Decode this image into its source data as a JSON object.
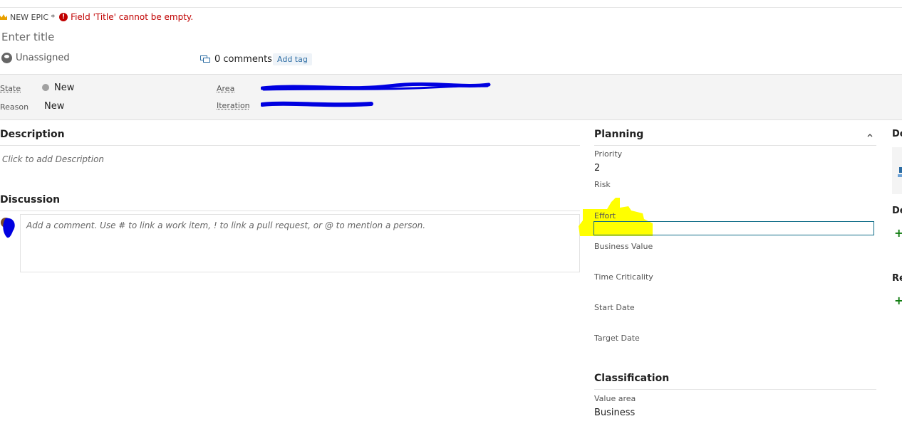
{
  "header": {
    "type_label": "NEW EPIC *",
    "error_text": "Field 'Title' cannot be empty."
  },
  "title": {
    "placeholder": "Enter title",
    "value": ""
  },
  "assignment": {
    "label": "Unassigned"
  },
  "comments": {
    "label": "0 comments"
  },
  "tags": {
    "add_label": "Add tag"
  },
  "state_band": {
    "state_label": "State",
    "state_value": "New",
    "reason_label": "Reason",
    "reason_value": "New",
    "area_label": "Area",
    "iteration_label": "Iteration"
  },
  "description": {
    "title": "Description",
    "placeholder": "Click to add Description"
  },
  "discussion": {
    "title": "Discussion",
    "placeholder": "Add a comment. Use # to link a work item, ! to link a pull request, or @ to mention a person."
  },
  "planning": {
    "title": "Planning",
    "fields": [
      {
        "label": "Priority",
        "value": "2"
      },
      {
        "label": "Risk",
        "value": ""
      },
      {
        "label": "Effort",
        "value": ""
      },
      {
        "label": "Business Value",
        "value": ""
      },
      {
        "label": "Time Criticality",
        "value": ""
      },
      {
        "label": "Start Date",
        "value": ""
      },
      {
        "label": "Target Date",
        "value": ""
      }
    ]
  },
  "classification": {
    "title": "Classification",
    "value_area_label": "Value area",
    "value_area_value": "Business"
  },
  "right_column": {
    "section1_title": "De",
    "section2_title": "De",
    "section3_title": "Re"
  },
  "colors": {
    "error": "#c00000",
    "accent": "#0f6d88",
    "highlight": "#ffff00",
    "scribble": "#0000e0",
    "add_green": "#107c10",
    "crown": "#e8a000"
  },
  "icons": {
    "crown": "crown-icon",
    "error": "error-icon",
    "avatar": "avatar-icon",
    "comment": "comment-icon",
    "collapse": "chevron-up-icon",
    "add": "plus-icon"
  }
}
